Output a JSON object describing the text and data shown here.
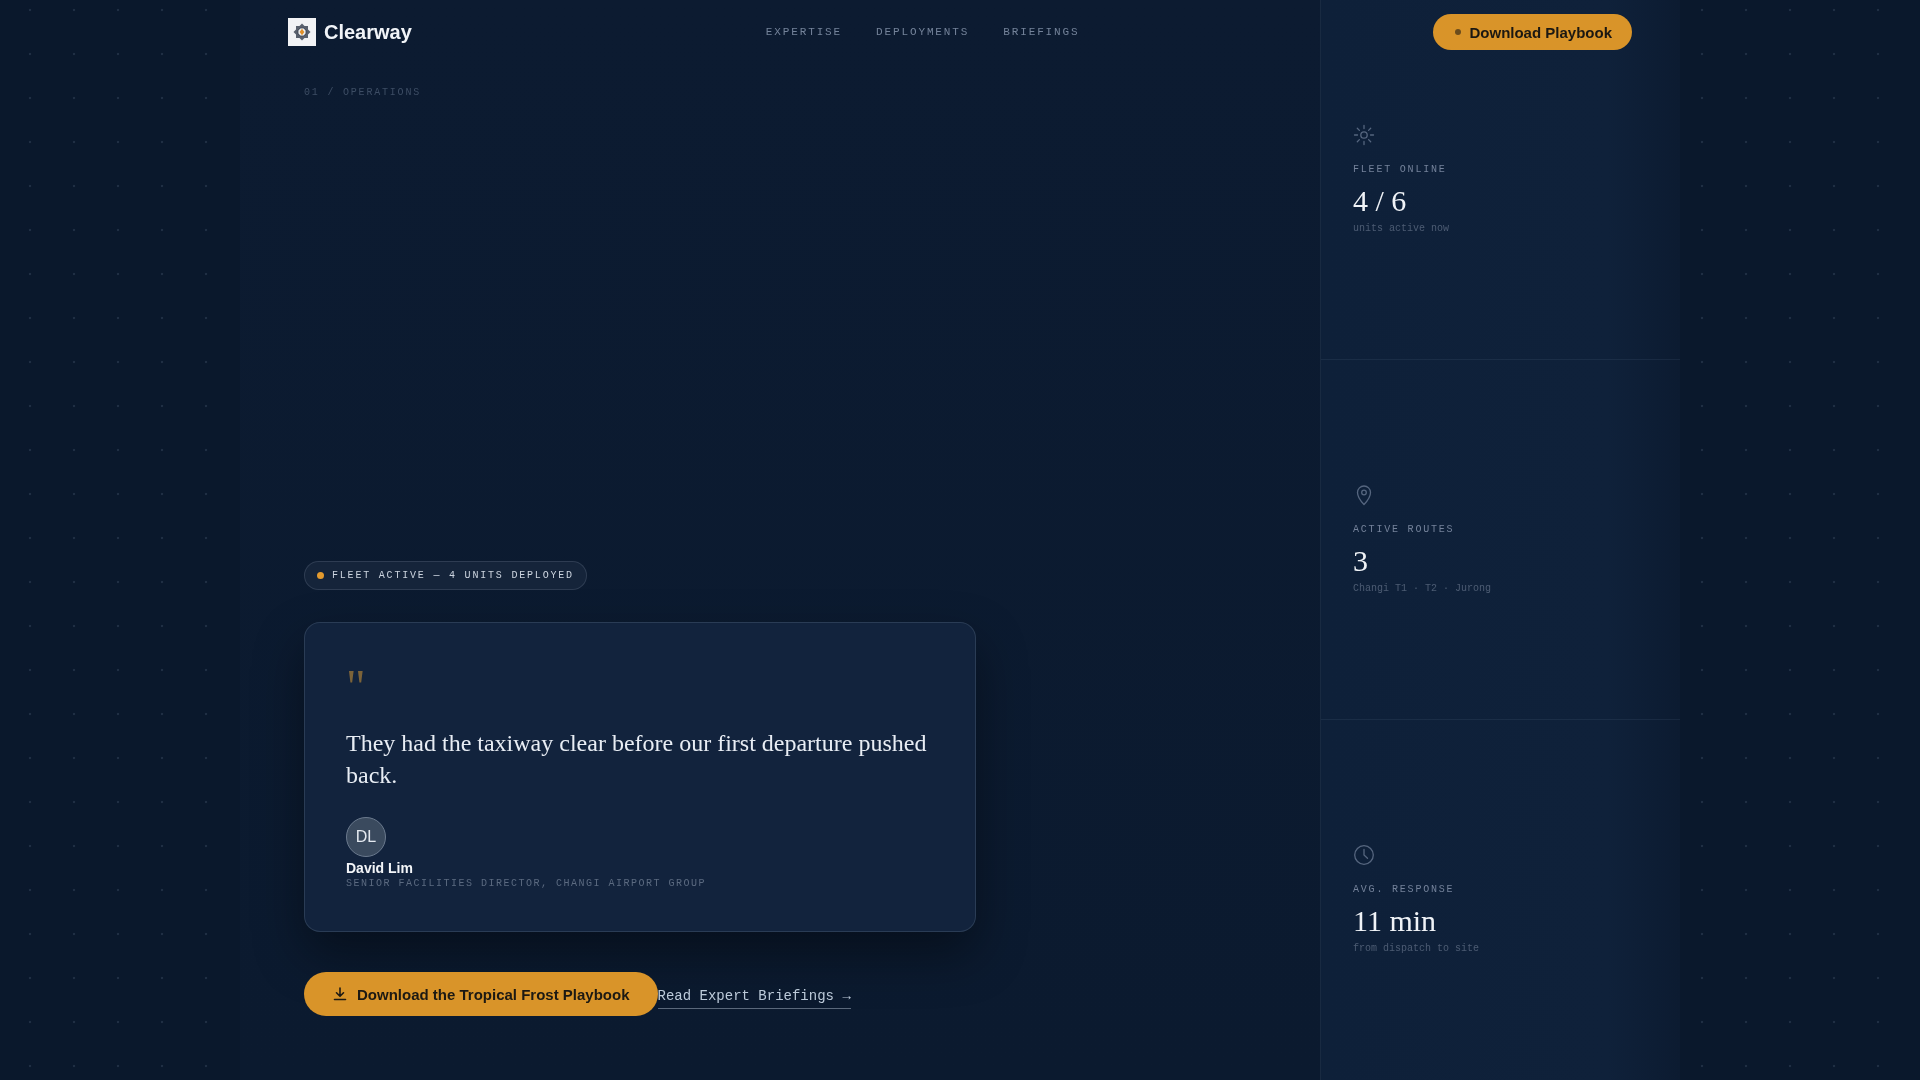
{
  "brand": {
    "name": "Clearway"
  },
  "nav": {
    "links": [
      "EXPERTISE",
      "DEPLOYMENTS",
      "BRIEFINGS"
    ],
    "cta": "Download Playbook"
  },
  "hero": {
    "eyebrow": "01 / OPERATIONS",
    "status_badge": "FLEET ACTIVE — 4 UNITS DEPLOYED",
    "testimonial": {
      "quote_mark": "\"",
      "quote": "They had the taxiway clear before our first departure pushed back.",
      "author_initials": "DL",
      "author_name": "David Lim",
      "author_role": "SENIOR FACILITIES DIRECTOR, CHANGI AIRPORT GROUP"
    },
    "primary_button": "Download the Tropical Frost Playbook",
    "secondary_link": "Read Expert Briefings →"
  },
  "stats": [
    {
      "kind": "sun",
      "label": "FLEET ONLINE",
      "value": "4 / 6",
      "note": "units active now"
    },
    {
      "kind": "pin",
      "label": "ACTIVE ROUTES",
      "value": "3",
      "note": "Changi T1 · T2 · Jurong"
    },
    {
      "kind": "clock",
      "label": "AVG. RESPONSE",
      "value": "11 min",
      "note": "from dispatch to site"
    }
  ]
}
